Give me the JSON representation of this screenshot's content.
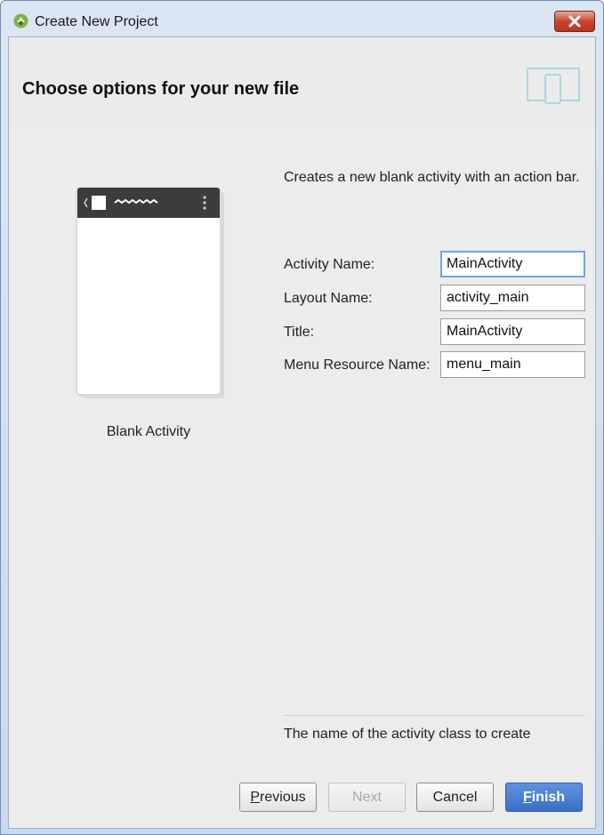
{
  "window": {
    "title": "Create New Project",
    "app_icon": "android-studio-icon"
  },
  "header": {
    "title": "Choose options for your new file",
    "icon": "device-icon"
  },
  "template": {
    "caption": "Blank Activity"
  },
  "description": "Creates a new blank activity with an action bar.",
  "form": {
    "fields": [
      {
        "label": "Activity Name:",
        "value": "MainActivity"
      },
      {
        "label": "Layout Name:",
        "value": "activity_main"
      },
      {
        "label": "Title:",
        "value": "MainActivity"
      },
      {
        "label": "Menu Resource Name:",
        "value": "menu_main"
      }
    ]
  },
  "hint": "The name of the activity class to create",
  "buttons": {
    "previous": "Previous",
    "next": "Next",
    "cancel": "Cancel",
    "finish": "Finish"
  },
  "colors": {
    "accent": "#3a6fc6",
    "focus_ring": "#6aa6e8",
    "close": "#c9452f"
  }
}
